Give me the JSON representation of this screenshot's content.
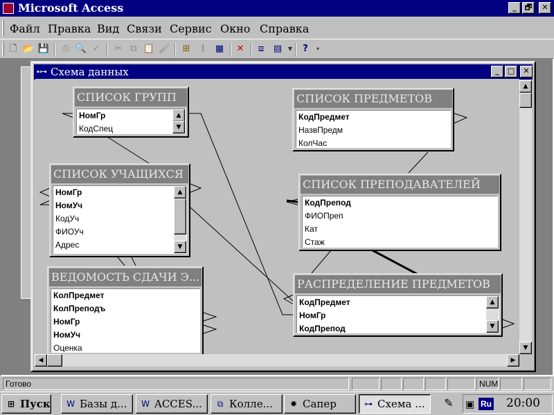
{
  "app": {
    "title": "Microsoft Access"
  },
  "title_buttons": {
    "minimize": "_",
    "restore": "🗗",
    "close": "✕"
  },
  "menu": [
    "Файл",
    "Правка",
    "Вид",
    "Связи",
    "Сервис",
    "Окно",
    "Справка"
  ],
  "toolbar_icons": [
    "new-icon",
    "open-icon",
    "save-icon",
    "print-icon",
    "preview-icon",
    "spelling-icon",
    "cut-icon",
    "copy-icon",
    "paste-icon",
    "format-painter-icon",
    "show-table-icon",
    "show-direct-icon",
    "show-all-icon",
    "delete-icon",
    "new-object-icon",
    "database-window-icon",
    "help-icon"
  ],
  "relwin": {
    "title": "Схема данных"
  },
  "tables": [
    {
      "id": "groups",
      "title": "СПИСОК ГРУПП",
      "fields": [
        {
          "name": "НомГр",
          "key": true
        },
        {
          "name": "КодСпец",
          "key": false
        }
      ]
    },
    {
      "id": "students",
      "title": "СПИСОК УЧАЩИХСЯ",
      "fields": [
        {
          "name": "НомГр",
          "key": true
        },
        {
          "name": "НомУч",
          "key": true
        },
        {
          "name": "КодУч",
          "key": false
        },
        {
          "name": "ФИОУч",
          "key": false
        },
        {
          "name": "Адрес",
          "key": false
        }
      ]
    },
    {
      "id": "grades",
      "title": "ВЕДОМОСТЬ СДАЧИ Э...",
      "fields": [
        {
          "name": "КолПредмет",
          "key": true
        },
        {
          "name": "КолПреподъ",
          "key": true
        },
        {
          "name": "НомГр",
          "key": true
        },
        {
          "name": "НомУч",
          "key": true
        },
        {
          "name": "Оценка",
          "key": false
        }
      ]
    },
    {
      "id": "subjects",
      "title": "СПИСОК ПРЕДМЕТОВ",
      "fields": [
        {
          "name": "КодПредмет",
          "key": true
        },
        {
          "name": "НазвПредм",
          "key": false
        },
        {
          "name": "КолЧас",
          "key": false
        }
      ]
    },
    {
      "id": "teachers",
      "title": "СПИСОК ПРЕПОДАВАТЕЛЕЙ",
      "fields": [
        {
          "name": "КодПрепод",
          "key": true
        },
        {
          "name": "ФИОПреп",
          "key": false
        },
        {
          "name": "Кат",
          "key": false
        },
        {
          "name": "Стаж",
          "key": false
        }
      ]
    },
    {
      "id": "distribution",
      "title": "РАСПРЕДЕЛЕНИЕ ПРЕДМЕТОВ",
      "fields": [
        {
          "name": "КодПредмет",
          "key": true
        },
        {
          "name": "НомГр",
          "key": true
        },
        {
          "name": "КодПрепод",
          "key": true
        }
      ]
    }
  ],
  "status": {
    "text": "Готово",
    "num": "NUM"
  },
  "taskbar": {
    "start": "Пуск",
    "tasks": [
      "Базы д...",
      "ACCES...",
      "Колле...",
      "Сапер",
      "Схема ..."
    ],
    "lang": "Ru",
    "clock": "20:00"
  }
}
